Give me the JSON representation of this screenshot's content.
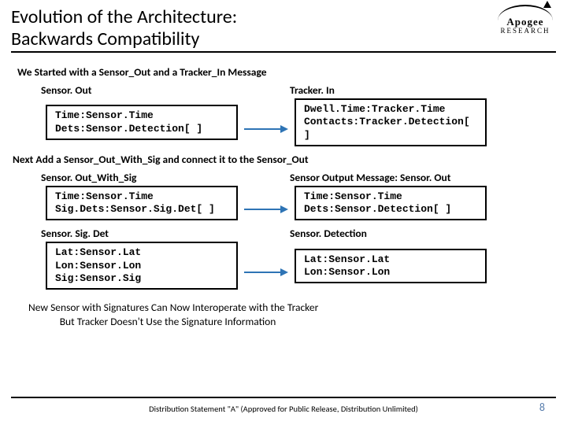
{
  "title_line1": "Evolution of the Architecture:",
  "title_line2": "Backwards Compatibility",
  "logo": {
    "name": "Apogee",
    "sub": "RESEARCH"
  },
  "section1": {
    "lead": "We Started with a Sensor_Out and a Tracker_In Message",
    "left": {
      "label": "Sensor. Out",
      "line1": "Time:Sensor.Time",
      "line2": "Dets:Sensor.Detection[ ]"
    },
    "right": {
      "label": "Tracker. In",
      "line1": "Dwell.Time:Tracker.Time",
      "line2": "Contacts:Tracker.Detection[ ]"
    }
  },
  "section2": {
    "lead": "Next Add a Sensor_Out_With_Sig and connect it to the Sensor_Out",
    "row1": {
      "left": {
        "label": "Sensor. Out_With_Sig",
        "line1": "Time:Sensor.Time",
        "line2": "Sig.Dets:Sensor.Sig.Det[ ]"
      },
      "right": {
        "label": "Sensor Output Message: Sensor. Out",
        "line1": "Time:Sensor.Time",
        "line2": "Dets:Sensor.Detection[ ]"
      }
    },
    "row2": {
      "left": {
        "label": "Sensor. Sig. Det",
        "line1": "Lat:Sensor.Lat",
        "line2": "Lon:Sensor.Lon",
        "line3": "Sig:Sensor.Sig"
      },
      "right": {
        "label": "Sensor. Detection",
        "line1": "Lat:Sensor.Lat",
        "line2": "Lon:Sensor.Lon"
      }
    }
  },
  "conclusion_line1": "New Sensor with Signatures Can Now Interoperate with the Tracker",
  "conclusion_line2": "But Tracker Doesn't Use the Signature Information",
  "footer": "Distribution Statement \"A\" (Approved for Public Release, Distribution Unlimited)",
  "page": "8"
}
